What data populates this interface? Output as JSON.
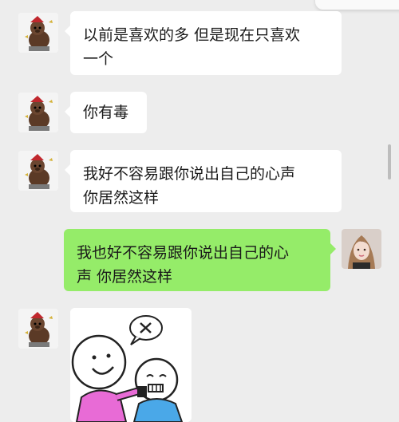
{
  "chat": {
    "messages": [
      {
        "sender": "left",
        "avatar": "bear-doll-avatar",
        "text": "以前是喜欢的多 但是现在只喜欢\n一个"
      },
      {
        "sender": "left",
        "avatar": "bear-doll-avatar",
        "text": "你有毒"
      },
      {
        "sender": "left",
        "avatar": "bear-doll-avatar",
        "text": "我好不容易跟你说出自己的心声\n你居然这样"
      },
      {
        "sender": "right",
        "avatar": "girl-selfie-avatar",
        "text": "我也好不容易跟你说出自己的心\n声 你居然这样"
      },
      {
        "sender": "left",
        "avatar": "bear-doll-avatar",
        "type": "sticker",
        "sticker": "two-cartoon-figures-sticker"
      }
    ]
  },
  "colors": {
    "background": "#ededed",
    "left_bubble": "#ffffff",
    "right_bubble": "#95ec69",
    "text": "#1a1a1a"
  }
}
